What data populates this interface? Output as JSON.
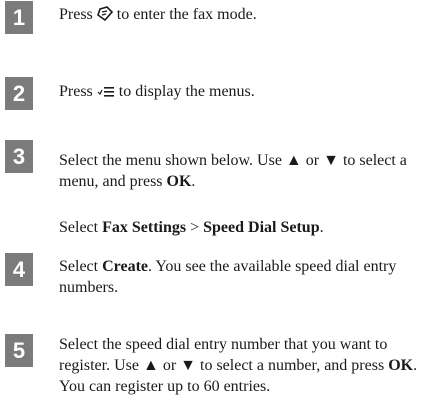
{
  "steps": [
    {
      "number": "1",
      "lines": [
        {
          "text_before": "Press ",
          "icon": "fax-icon",
          "text_after": " to enter the fax mode."
        }
      ]
    },
    {
      "number": "2",
      "lines": [
        {
          "text_before": "Press ",
          "icon": "menu-icon",
          "text_after": " to display the menus."
        }
      ]
    },
    {
      "number": "3",
      "para1": {
        "part1": "Select the menu shown below. Use ",
        "up": "▲",
        "or": " or ",
        "down": "▼",
        "part2": " to select a menu, and press ",
        "ok": "OK",
        "end": "."
      },
      "para2": {
        "prefix": "Select ",
        "menu1": "Fax Settings",
        "sep": " > ",
        "menu2": "Speed Dial Setup",
        "end": "."
      }
    },
    {
      "number": "4",
      "para": {
        "prefix": "Select ",
        "bold": "Create",
        "suffix": ". You see the available speed dial entry numbers."
      }
    },
    {
      "number": "5",
      "para": {
        "part1": "Select the speed dial entry number that you want to register. Use ",
        "up": "▲",
        "or": " or ",
        "down": "▼",
        "part2": " to select a number, and press ",
        "ok": "OK",
        "part3": ". You can register up to 60 entries."
      }
    }
  ]
}
